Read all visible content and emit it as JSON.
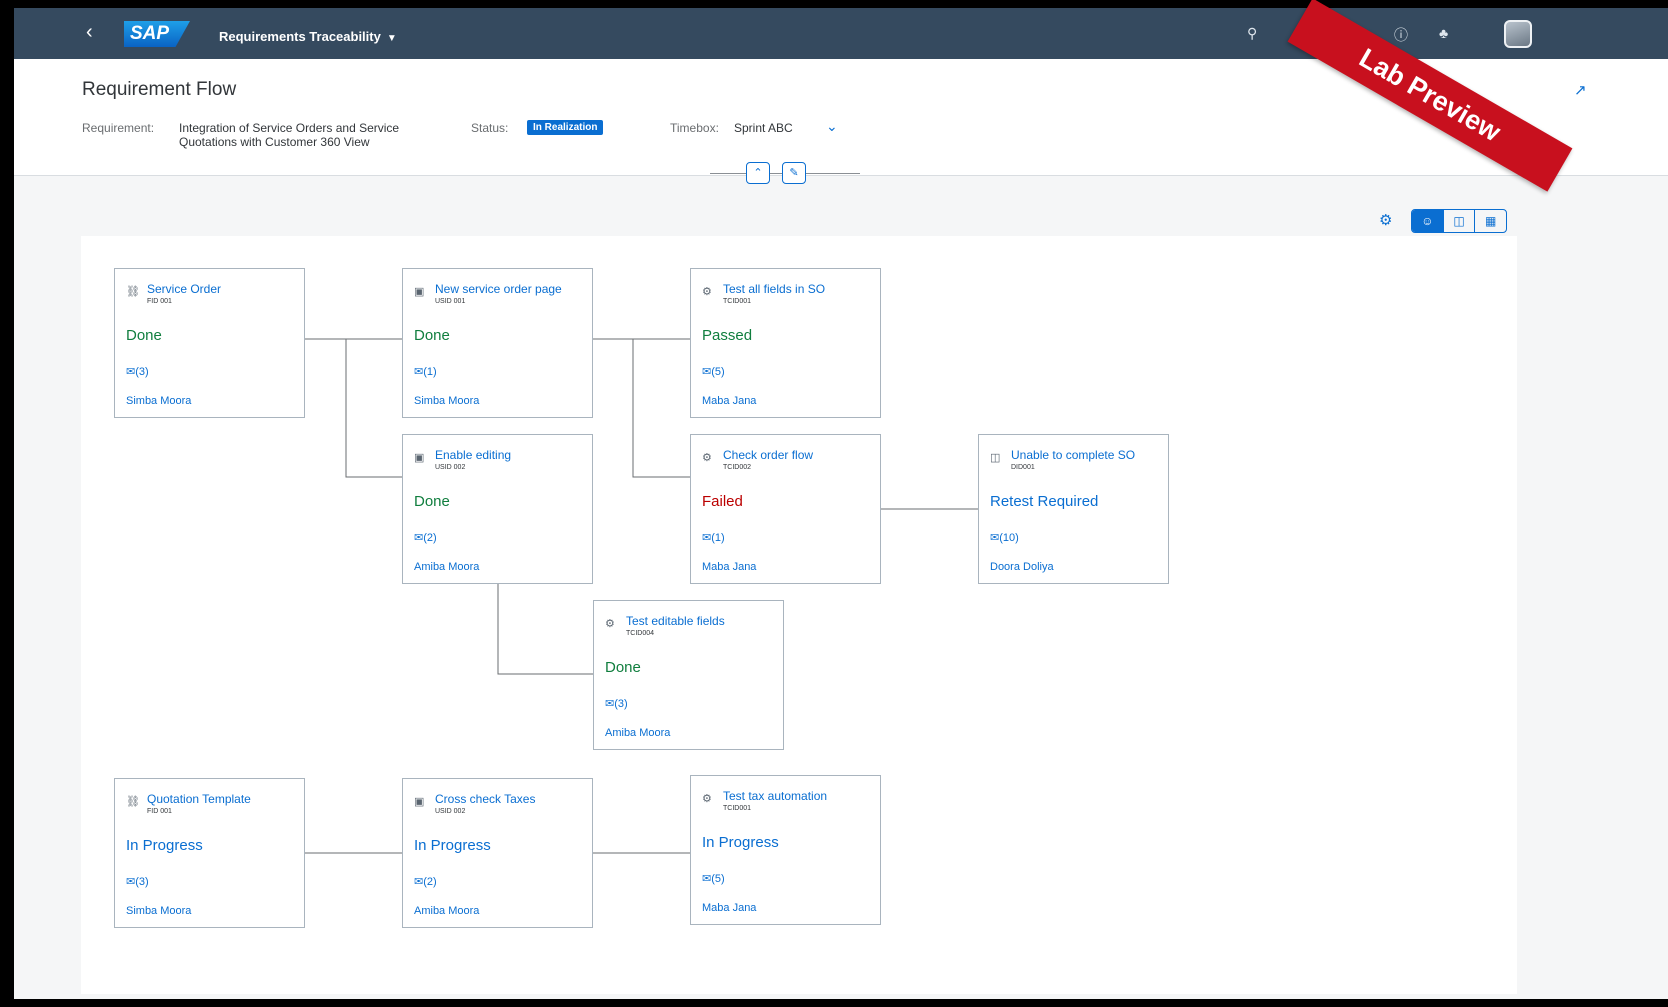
{
  "shell": {
    "logo": "SAP",
    "app_title": "Requirements Traceability",
    "icons": [
      "back-icon",
      "search-icon",
      "help-icon",
      "bell-icon",
      "avatar"
    ]
  },
  "header": {
    "title": "Requirement Flow",
    "requirement_label": "Requirement:",
    "requirement_value": "Integration of Service Orders and Service Quotations with Customer 360 View",
    "status_label": "Status:",
    "status_value": "In Realization",
    "timebox_label": "Timebox:",
    "timebox_value": "Sprint ABC"
  },
  "ribbon": "Lab Preview",
  "colors": {
    "shell": "#354a5f",
    "accent": "#0a6ed1",
    "positive": "#107e3e",
    "negative": "#bb0000",
    "ribbon": "#c8101e"
  },
  "nodes": [
    {
      "icon": "feature-icon",
      "title": "Service Order",
      "id": "FID 001",
      "status": "Done",
      "status_color": "green",
      "comments": "(3)",
      "owner": "Simba Moora"
    },
    {
      "icon": "story-icon",
      "title": "New service order page",
      "id": "USID 001",
      "status": "Done",
      "status_color": "green",
      "comments": "(1)",
      "owner": "Simba Moora"
    },
    {
      "icon": "test-icon",
      "title": "Test all fields in SO",
      "id": "TCID001",
      "status": "Passed",
      "status_color": "green",
      "comments": "(5)",
      "owner": "Maba Jana"
    },
    {
      "icon": "story-icon",
      "title": "Enable editing",
      "id": "USID 002",
      "status": "Done",
      "status_color": "green",
      "comments": "(2)",
      "owner": "Amiba Moora"
    },
    {
      "icon": "test-icon",
      "title": "Check order flow",
      "id": "TCID002",
      "status": "Failed",
      "status_color": "red",
      "comments": "(1)",
      "owner": "Maba Jana"
    },
    {
      "icon": "defect-icon",
      "title": "Unable to complete SO",
      "id": "DID001",
      "status": "Retest Required",
      "status_color": "blue",
      "comments": "(10)",
      "owner": "Doora Doliya"
    },
    {
      "icon": "test-icon",
      "title": "Test editable fields",
      "id": "TCID004",
      "status": "Done",
      "status_color": "green",
      "comments": "(3)",
      "owner": "Amiba Moora"
    },
    {
      "icon": "feature-icon",
      "title": "Quotation Template",
      "id": "FID 001",
      "status": "In Progress",
      "status_color": "blue",
      "comments": "(3)",
      "owner": "Simba Moora"
    },
    {
      "icon": "story-icon",
      "title": "Cross check Taxes",
      "id": "USID 002",
      "status": "In Progress",
      "status_color": "blue",
      "comments": "(2)",
      "owner": "Amiba Moora"
    },
    {
      "icon": "test-icon",
      "title": "Test tax automation",
      "id": "TCID001",
      "status": "In Progress",
      "status_color": "blue",
      "comments": "(5)",
      "owner": "Maba Jana"
    }
  ]
}
